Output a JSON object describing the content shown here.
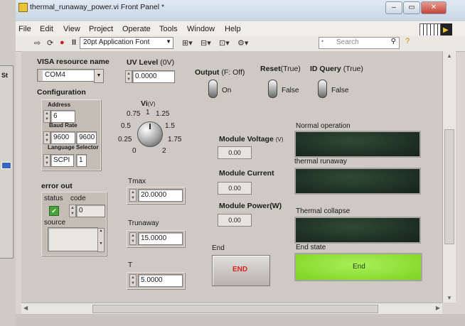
{
  "window": {
    "title": "thermal_runaway_power.vi Front Panel *",
    "min_glyph": "–",
    "max_glyph": "▭",
    "close_glyph": "✕"
  },
  "left_sliver": {
    "label": "St"
  },
  "menu": [
    "File",
    "Edit",
    "View",
    "Project",
    "Operate",
    "Tools",
    "Window",
    "Help"
  ],
  "toolbar": {
    "font_select": "20pt Application Font",
    "search_placeholder": "Search"
  },
  "visa": {
    "label": "VISA resource name",
    "value": "COM4"
  },
  "configuration": {
    "label": "Configuration",
    "address_label": "Address",
    "address_value": "6",
    "baud_label": "Baud Rate",
    "baud_value1": "9600",
    "baud_value2": "9600",
    "language_label": "Language",
    "selector_label": "Selector",
    "language_value": "SCPI",
    "selector_value": "1"
  },
  "uv_level": {
    "label": "UV Level",
    "unit": "(0V)",
    "value": "0.0000"
  },
  "vi_knob": {
    "label": "Vi",
    "unit": "(V)",
    "ticks": [
      "0",
      "0.25",
      "0.5",
      "0.75",
      "1",
      "1.25",
      "1.5",
      "1.75",
      "2"
    ],
    "value": 1.0
  },
  "output": {
    "label": "Output",
    "hint": "(F: Off)",
    "state": "On"
  },
  "reset": {
    "label": "Reset",
    "hint": "(True)",
    "state": "False"
  },
  "id_query": {
    "label": "ID Query",
    "hint": "(True)",
    "state": "False"
  },
  "error_out": {
    "label": "error out",
    "status_label": "status",
    "code_label": "code",
    "code_value": "0",
    "source_label": "source"
  },
  "tmax": {
    "label": "Tmax",
    "value": "20.0000"
  },
  "trunaway": {
    "label": "Trunaway",
    "value": "15.0000"
  },
  "t": {
    "label": "T",
    "value": "5.0000"
  },
  "module_voltage": {
    "label": "Module Voltage",
    "unit": "(V)",
    "value": "0.00"
  },
  "module_current": {
    "label": "Module Current",
    "value": "0.00"
  },
  "module_power": {
    "label": "Module Power",
    "unit": "(W)",
    "value": "0.00"
  },
  "leds": {
    "normal_label": "Normal operation",
    "runaway_label": "thermal runaway",
    "collapse_label": "Thermal collapse",
    "end_state_label": "End state",
    "end_state_text": "End",
    "end_state_color": "#7ed321"
  },
  "end_button": {
    "label": "End",
    "text": "END",
    "text_color": "#e02020"
  },
  "scroll_glyphs": {
    "up": "▲",
    "down": "▼",
    "left": "◀",
    "right": "▶"
  }
}
